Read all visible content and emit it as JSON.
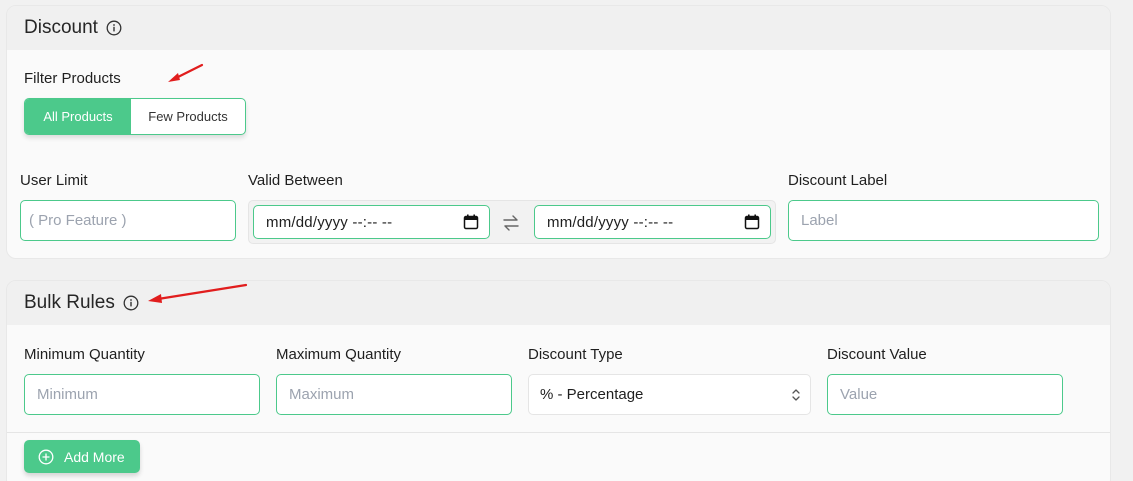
{
  "discount": {
    "title": "Discount",
    "filter_label": "Filter Products",
    "filter_options": [
      "All Products",
      "Few Products"
    ],
    "filter_selected": "All Products",
    "user_limit_label": "User Limit",
    "user_limit_placeholder": "( Pro Feature )",
    "valid_between_label": "Valid Between",
    "date_from": "mm/dd/yyyy --:-- --",
    "date_to": "mm/dd/yyyy --:-- --",
    "discount_label_label": "Discount Label",
    "discount_label_placeholder": "Label"
  },
  "bulk_rules": {
    "title": "Bulk Rules",
    "min_qty_label": "Minimum Quantity",
    "min_qty_placeholder": "Minimum",
    "max_qty_label": "Maximum Quantity",
    "max_qty_placeholder": "Maximum",
    "discount_type_label": "Discount Type",
    "discount_type_value": "% - Percentage",
    "discount_value_label": "Discount Value",
    "discount_value_placeholder": "Value",
    "add_more_label": "Add More"
  },
  "colors": {
    "accent": "#4cc98b",
    "annotation_arrow": "#e11d1d"
  }
}
